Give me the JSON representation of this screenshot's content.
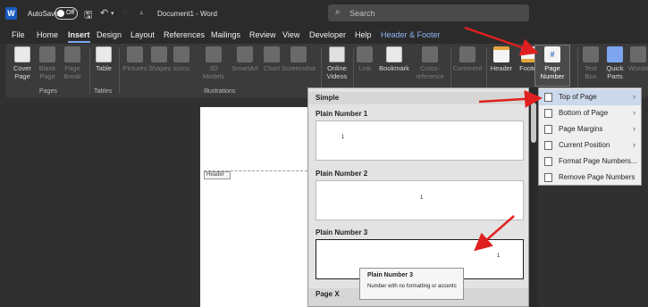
{
  "titlebar": {
    "autosave_label": "AutoSave",
    "autosave_state": "Off",
    "doc_title": "Document1 - Word",
    "search_placeholder": "Search"
  },
  "tabs": [
    "File",
    "Home",
    "Insert",
    "Design",
    "Layout",
    "References",
    "Mailings",
    "Review",
    "View",
    "Developer",
    "Help",
    "Header & Footer"
  ],
  "active_tab": "Insert",
  "ribbon": {
    "pages": {
      "cover_page": "Cover Page",
      "blank_page": "Blank Page",
      "page_break": "Page Break",
      "group": "Pages"
    },
    "tables": {
      "table": "Table",
      "group": "Tables"
    },
    "illustrations": {
      "pictures": "Pictures",
      "shapes": "Shapes",
      "icons": "Icons",
      "models": "3D Models",
      "smartart": "SmartArt",
      "chart": "Chart",
      "screenshot": "Screenshot",
      "group": "Illustrations"
    },
    "media": {
      "online_videos": "Online Videos"
    },
    "links": {
      "link": "Link",
      "bookmark": "Bookmark",
      "cross_reference": "Cross-reference"
    },
    "comments": {
      "comment": "Comment"
    },
    "header_footer": {
      "header": "Header",
      "footer": "Footer",
      "page_number": "Page Number"
    },
    "text": {
      "text_box": "Text Box",
      "quick_parts": "Quick Parts",
      "wordart": "WordArt"
    }
  },
  "document": {
    "header_tag": "Header"
  },
  "gallery": {
    "section_simple": "Simple",
    "items": [
      {
        "label": "Plain Number 1",
        "number": "1"
      },
      {
        "label": "Plain Number 2",
        "number": "1"
      },
      {
        "label": "Plain Number 3",
        "number": "1"
      }
    ],
    "section_next": "Page X"
  },
  "tooltip": {
    "title": "Plain Number 3",
    "description": "Number with no formatting or accents"
  },
  "menu": {
    "items": [
      {
        "label": "Top of Page",
        "submenu": true
      },
      {
        "label": "Bottom of Page",
        "submenu": true
      },
      {
        "label": "Page Margins",
        "submenu": true
      },
      {
        "label": "Current Position",
        "submenu": true
      },
      {
        "label": "Format Page Numbers...",
        "submenu": false
      },
      {
        "label": "Remove Page Numbers",
        "submenu": false
      }
    ]
  },
  "colors": {
    "arrow": "#e02020",
    "accent": "#7ea6f0",
    "context_tab": "#8fb4f5"
  }
}
